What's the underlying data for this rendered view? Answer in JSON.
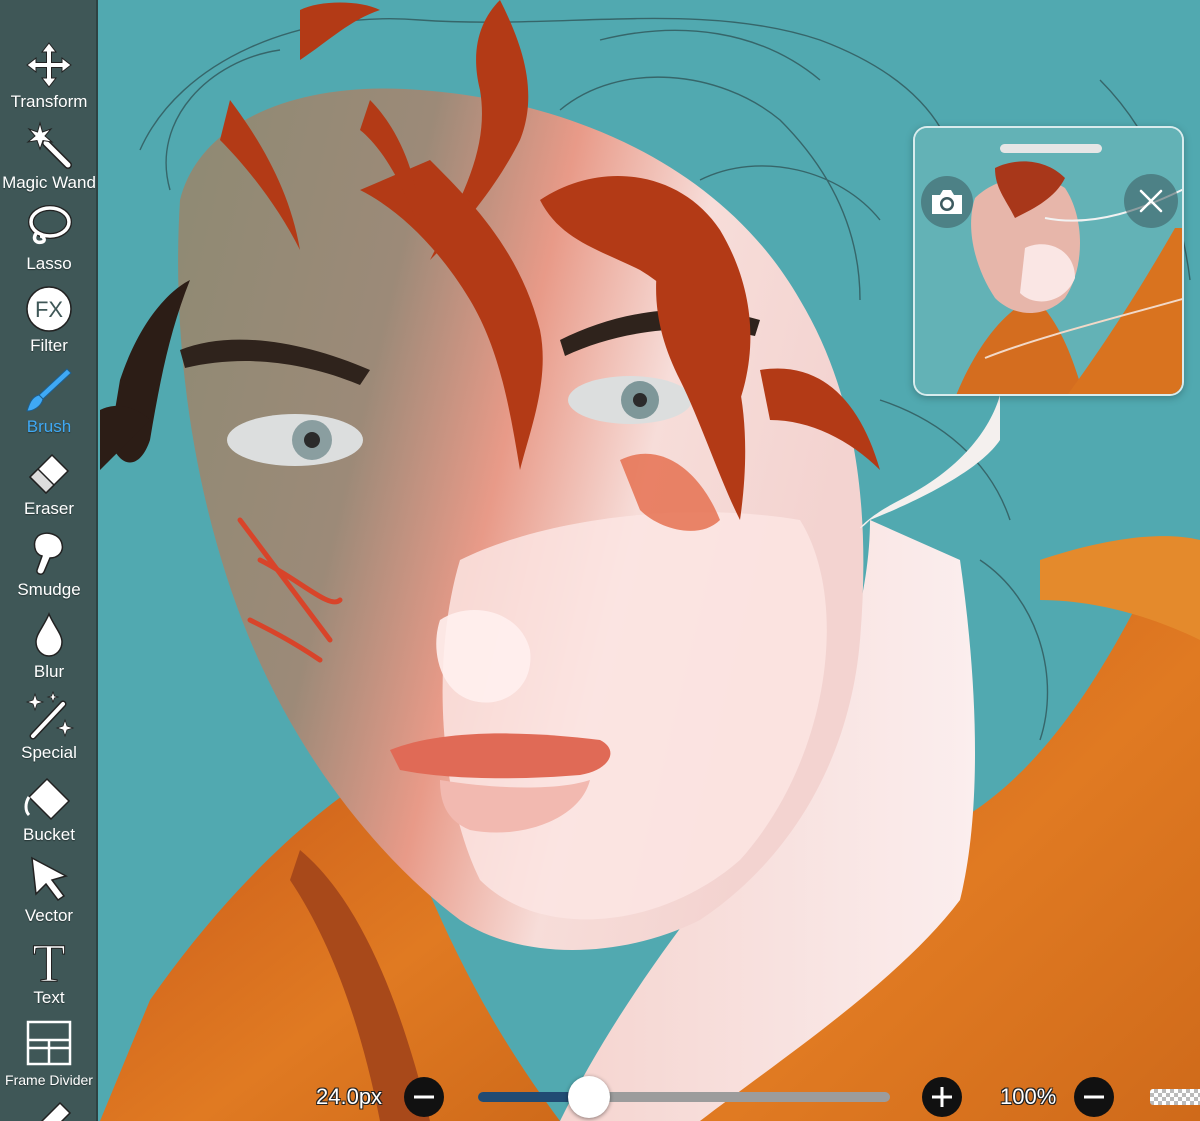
{
  "toolbar": {
    "items": [
      {
        "label": "Transform",
        "icon": "move-arrows-icon",
        "active": false
      },
      {
        "label": "Magic Wand",
        "icon": "magic-wand-icon",
        "active": false
      },
      {
        "label": "Lasso",
        "icon": "lasso-icon",
        "active": false
      },
      {
        "label": "Filter",
        "icon": "fx-icon",
        "active": false
      },
      {
        "label": "Brush",
        "icon": "brush-icon",
        "active": true
      },
      {
        "label": "Eraser",
        "icon": "eraser-icon",
        "active": false
      },
      {
        "label": "Smudge",
        "icon": "smudge-finger-icon",
        "active": false
      },
      {
        "label": "Blur",
        "icon": "droplet-icon",
        "active": false
      },
      {
        "label": "Special",
        "icon": "sparkle-wand-icon",
        "active": false
      },
      {
        "label": "Bucket",
        "icon": "bucket-icon",
        "active": false
      },
      {
        "label": "Vector",
        "icon": "cursor-arrow-icon",
        "active": false
      },
      {
        "label": "Text",
        "icon": "text-t-icon",
        "active": false
      },
      {
        "label": "Frame Divider",
        "icon": "frame-divider-icon",
        "active": false
      }
    ],
    "fx_glyph": "FX",
    "text_glyph": "T"
  },
  "navigator": {
    "camera_icon": "camera-icon",
    "close_icon": "close-icon"
  },
  "bottom_bar": {
    "brush_size": "24.0px",
    "brush_size_fraction": 0.27,
    "opacity": "100%"
  },
  "colors": {
    "canvas_background": "#51a9b0",
    "toolbar_background": "#3f5757",
    "active_tool": "#3fa9f5",
    "hair": "#b33a16",
    "hoodie": "#d9741e",
    "skin_light": "#f6d6d3",
    "slider_fill": "#214b73"
  }
}
